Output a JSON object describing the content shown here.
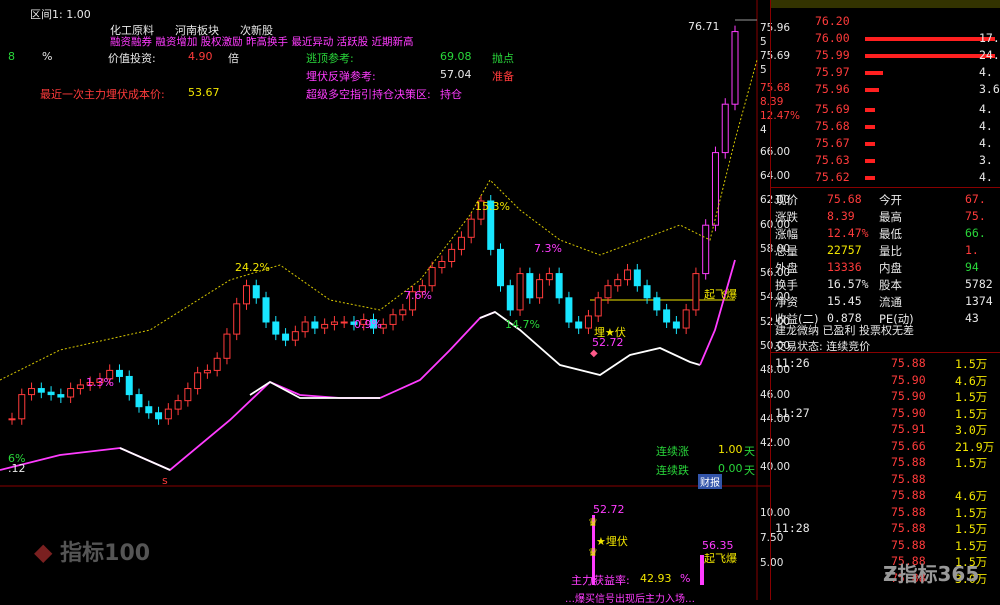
{
  "top": {
    "period": "区间1: 1.00",
    "tags": [
      "化工原料",
      "河南板块",
      "次新股"
    ],
    "concepts": "融资融券 融资增加 股权激励 昨高换手 最近异动 活跃股 近期新高",
    "left_num": "8",
    "pct": "%",
    "value_label": "价值投资:",
    "value_num": "4.90",
    "value_unit": "倍",
    "cost_label": "最近一次主力埋伏成本价:",
    "cost_val": "53.67",
    "ref1_label": "逃顶参考:",
    "ref1_val": "69.08",
    "ref1_tag": "抛点",
    "ref2_label": "埋伏反弹参考:",
    "ref2_val": "57.04",
    "ref2_tag": "准备",
    "ref3_label": "超级多空指引持仓决策区:",
    "ref3_tag": "持仓"
  },
  "annotations": {
    "peak_price": "76.71",
    "p1": "24.2%",
    "p2": "15.3%",
    "p3": "7.3%",
    "p4": "7.6%",
    "p5": "0.9%",
    "p6": "1.3%",
    "p7": "14.7%",
    "p8": "6%",
    "left_axis_low": ".12",
    "buy_label": "埋★伏",
    "buy_price": "52.72",
    "takeoff": "起飞爆",
    "s_mark": "s",
    "up_label": "连续涨",
    "up_val": "1.00",
    "up_unit": "天",
    "down_label": "连续跌",
    "down_val": "0.00",
    "down_unit": "天",
    "finance_tab": "财报"
  },
  "sub": {
    "v1": "52.72",
    "bury": "★埋伏",
    "v2": "56.35",
    "fly": "起飞爆",
    "profit_label": "主力获益率:",
    "profit_val": "42.93",
    "profit_unit": "%",
    "bottom_text": "…爆买信号出现后主力入场…"
  },
  "axis": {
    "ticks": [
      "75.96",
      "5",
      "75.69",
      "5",
      "75.68",
      "8.39",
      "12.47%",
      "4",
      "66.00",
      "64.00",
      "62.00",
      "60.00",
      "58.00",
      "56.00",
      "54.00",
      "52.00",
      "50.00",
      "48.00",
      "46.00",
      "44.00",
      "42.00",
      "40.00",
      "10.00",
      "7.50",
      "5.00"
    ]
  },
  "order_book": {
    "rows": [
      {
        "label": "",
        "price": "76.20",
        "vol": ""
      },
      {
        "label": "",
        "price": "76.00",
        "vol": "17.5"
      },
      {
        "label": "",
        "price": "75.99",
        "vol": "24.3"
      },
      {
        "label": "",
        "price": "75.97",
        "vol": "4."
      },
      {
        "label": "",
        "price": "75.96",
        "vol": "3.6"
      },
      {
        "label": "",
        "price": "75.69",
        "vol": "4."
      },
      {
        "label": "",
        "price": "75.68",
        "vol": "4."
      },
      {
        "label": "",
        "price": "75.67",
        "vol": "4."
      },
      {
        "label": "",
        "price": "75.63",
        "vol": "3."
      },
      {
        "label": "",
        "price": "75.62",
        "vol": "4."
      }
    ]
  },
  "quote": {
    "rows": [
      {
        "k1": "现价",
        "v1": "75.68",
        "k2": "今开",
        "v2": "67."
      },
      {
        "k1": "涨跌",
        "v1": "8.39",
        "k2": "最高",
        "v2": "75."
      },
      {
        "k1": "涨幅",
        "v1": "12.47%",
        "k2": "最低",
        "v2": "66."
      },
      {
        "k1": "总量",
        "v1": "22757",
        "k2": "量比",
        "v2": "1."
      },
      {
        "k1": "外盘",
        "v1": "13336",
        "k2": "内盘",
        "v2": "94"
      },
      {
        "k1": "换手",
        "v1": "16.57%",
        "k2": "股本",
        "v2": "5782"
      },
      {
        "k1": "净资",
        "v1": "15.45",
        "k2": "流通",
        "v2": "1374"
      },
      {
        "k1": "收益(二)",
        "v1": "0.878",
        "k2": "PE(动)",
        "v2": "43"
      }
    ],
    "tags": "建龙微纳 已盈利 投票权无差",
    "status": "交易状态: 连续竞价"
  },
  "ticks": {
    "rows": [
      {
        "time": "11:26",
        "price": "75.88",
        "vol": "1.5万"
      },
      {
        "time": "",
        "price": "75.90",
        "vol": "4.6万"
      },
      {
        "time": "",
        "price": "75.90",
        "vol": "1.5万"
      },
      {
        "time": "11:27",
        "price": "75.90",
        "vol": "1.5万"
      },
      {
        "time": "",
        "price": "75.91",
        "vol": "3.0万"
      },
      {
        "time": "",
        "price": "75.66",
        "vol": "21.9万"
      },
      {
        "time": "",
        "price": "75.88",
        "vol": "1.5万"
      },
      {
        "time": "",
        "price": "75.88",
        "vol": ""
      },
      {
        "time": "",
        "price": "75.88",
        "vol": "4.6万"
      },
      {
        "time": "",
        "price": "75.88",
        "vol": "1.5万"
      },
      {
        "time": "11:28",
        "price": "75.88",
        "vol": "1.5万"
      },
      {
        "time": "",
        "price": "75.88",
        "vol": "1.5万"
      },
      {
        "time": "",
        "price": "75.88",
        "vol": "1.5万"
      },
      {
        "time": "",
        "price": "75.88",
        "vol": "3.0万"
      }
    ]
  },
  "watermarks": {
    "left": "指标100",
    "right": "指标365"
  }
}
